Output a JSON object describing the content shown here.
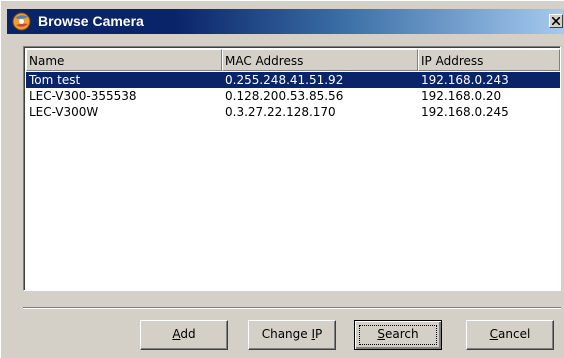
{
  "window": {
    "title": "Browse Camera",
    "icon": "camera-app-icon",
    "close_icon": "close-icon"
  },
  "list": {
    "columns": [
      "Name",
      "MAC Address",
      "IP Address"
    ],
    "rows": [
      {
        "name": "Tom test",
        "mac": "0.255.248.41.51.92",
        "ip": "192.168.0.243",
        "selected": true
      },
      {
        "name": "LEC-V300-355538",
        "mac": "0.128.200.53.85.56",
        "ip": "192.168.0.20",
        "selected": false
      },
      {
        "name": "LEC-V300W",
        "mac": "0.3.27.22.128.170",
        "ip": "192.168.0.245",
        "selected": false
      }
    ]
  },
  "buttons": {
    "add": {
      "label": "Add",
      "mnemonic_index": 0
    },
    "change_ip": {
      "label": "Change IP",
      "mnemonic_index": 7
    },
    "search": {
      "label": "Search",
      "mnemonic_index": 0
    },
    "cancel": {
      "label": "Cancel",
      "mnemonic_index": 0
    }
  },
  "colors": {
    "title_bar": "#0a246a",
    "selection": "#0a246a",
    "face": "#d4d0c8"
  }
}
